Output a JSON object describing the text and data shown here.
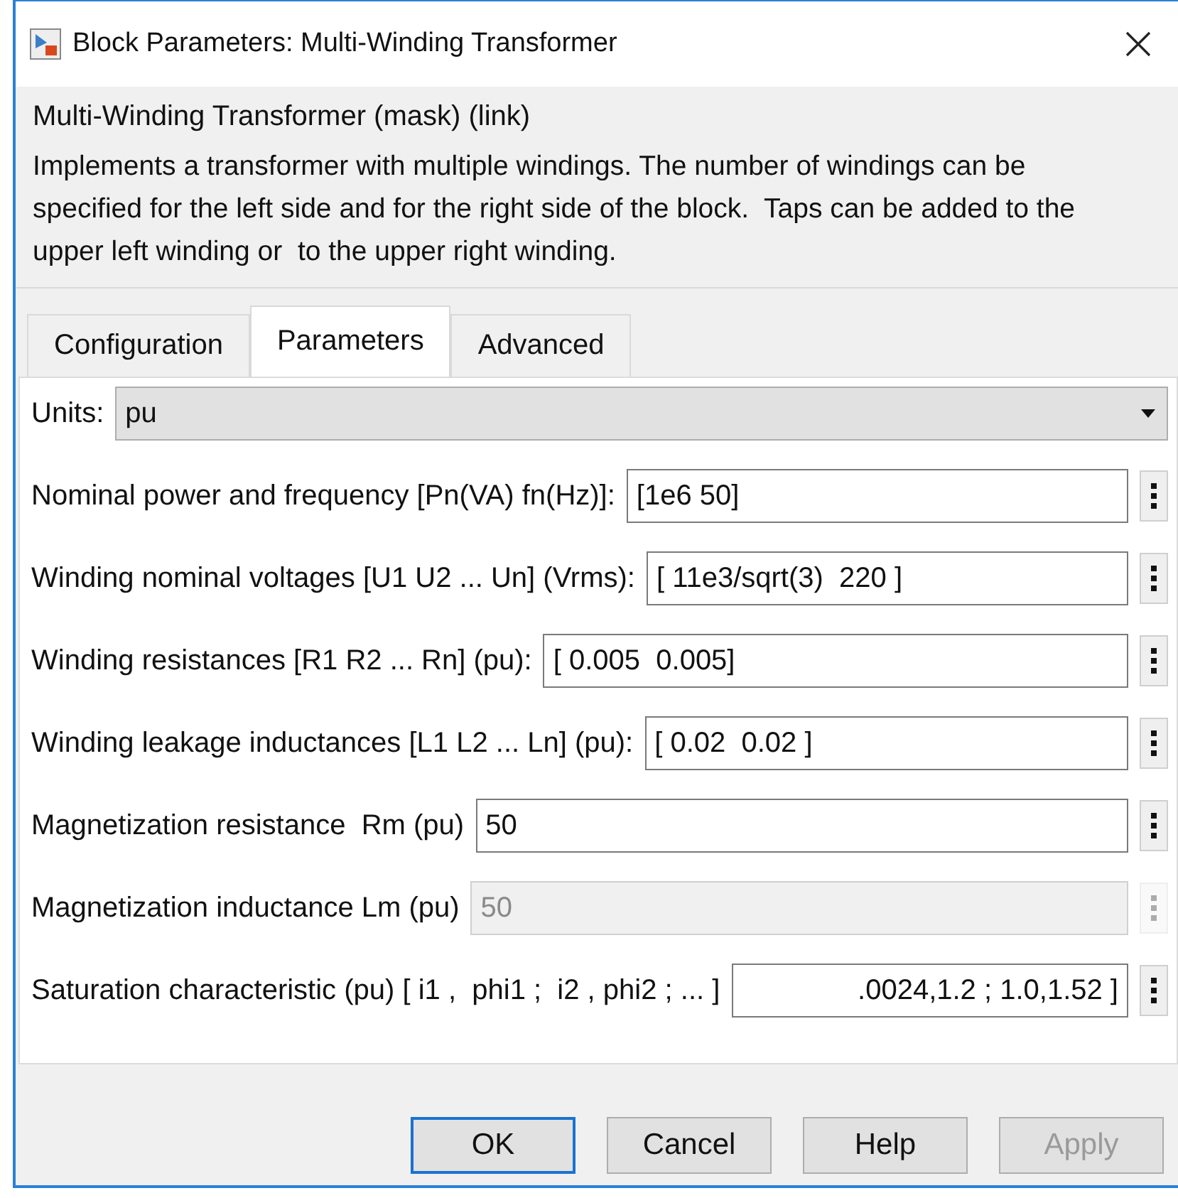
{
  "window": {
    "title": "Block Parameters: Multi-Winding Transformer"
  },
  "group": {
    "title": "Multi-Winding Transformer (mask) (link)",
    "description": "Implements a transformer with multiple windings. The number of windings can be specified for the left side and for the right side of the block.  Taps can be added to the upper left winding or  to the upper right winding."
  },
  "tabs": [
    {
      "label": "Configuration",
      "selected": false
    },
    {
      "label": "Parameters",
      "selected": true
    },
    {
      "label": "Advanced",
      "selected": false
    }
  ],
  "units": {
    "label": "Units:",
    "value": "pu"
  },
  "parameters": [
    {
      "label": "Nominal power and frequency [Pn(VA) fn(Hz)]:",
      "value": "[1e6 50]",
      "disabled": false
    },
    {
      "label": "Winding nominal voltages [U1 U2 ... Un] (Vrms):",
      "value": "[ 11e3/sqrt(3)  220 ]",
      "disabled": false
    },
    {
      "label": "Winding resistances [R1 R2 ... Rn] (pu):",
      "value": "[ 0.005  0.005]",
      "disabled": false
    },
    {
      "label": "Winding leakage inductances [L1 L2 ... Ln] (pu):",
      "value": "[ 0.02  0.02 ]",
      "disabled": false
    },
    {
      "label": "Magnetization resistance  Rm (pu)",
      "value": "50",
      "disabled": false
    },
    {
      "label": "Magnetization inductance Lm (pu)",
      "value": "50",
      "disabled": true
    },
    {
      "label": "Saturation characteristic (pu) [ i1 ,  phi1 ;  i2 , phi2 ; ... ]",
      "value": ".0024,1.2 ; 1.0,1.52 ]",
      "disabled": false
    }
  ],
  "buttons": [
    {
      "label": "OK",
      "focused": true,
      "disabled": false
    },
    {
      "label": "Cancel",
      "focused": false,
      "disabled": false
    },
    {
      "label": "Help",
      "focused": false,
      "disabled": false
    },
    {
      "label": "Apply",
      "focused": false,
      "disabled": true
    }
  ]
}
